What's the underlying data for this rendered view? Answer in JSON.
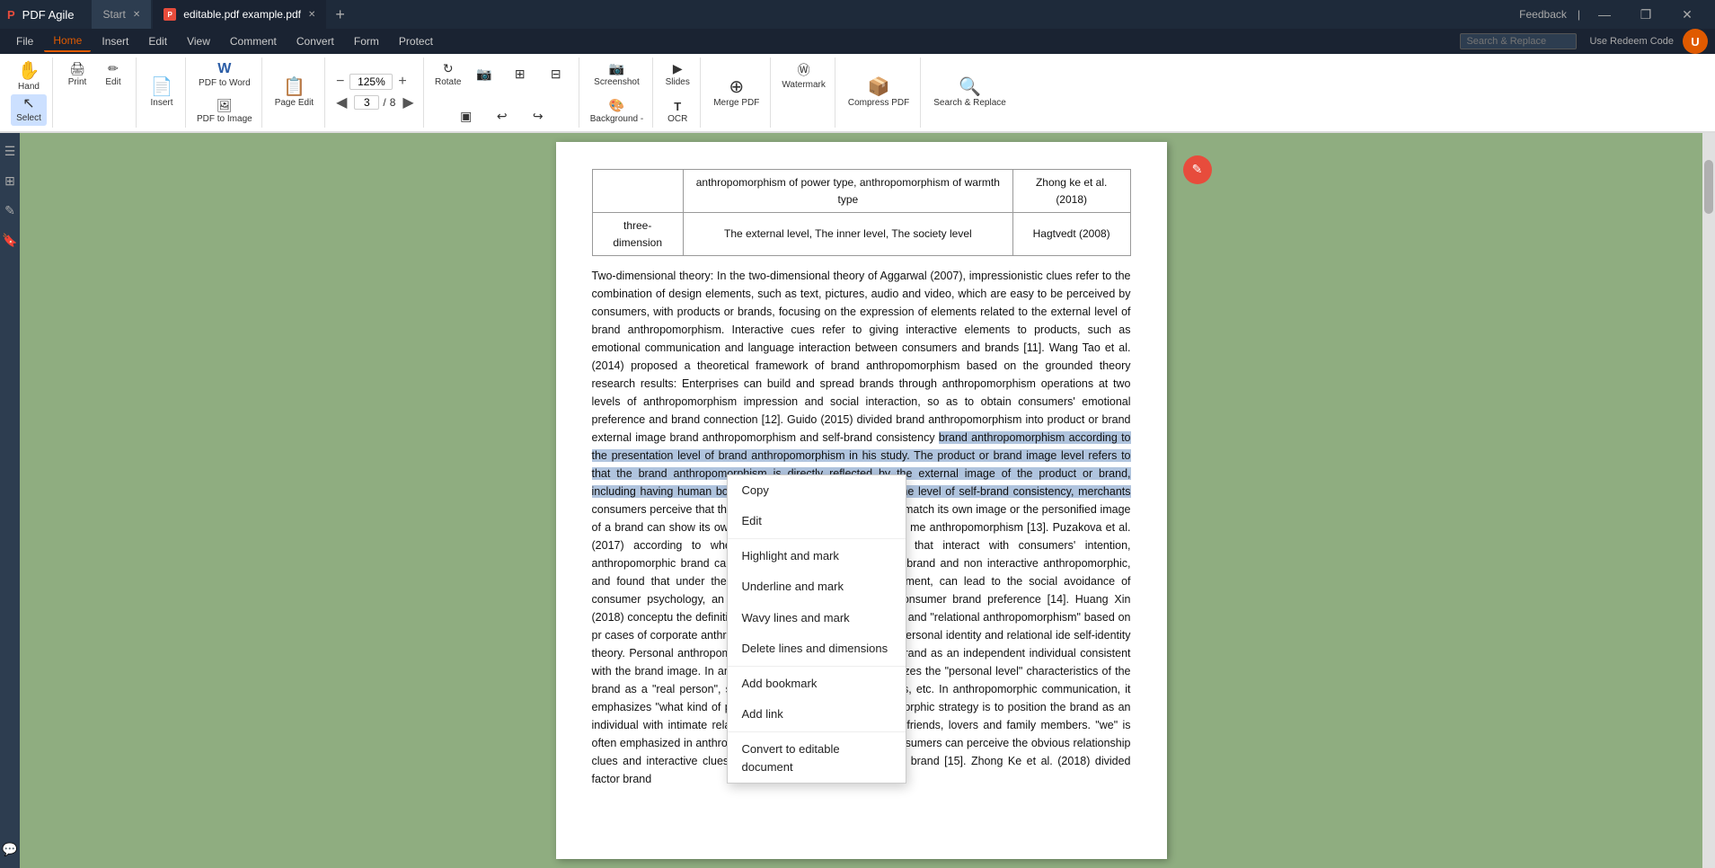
{
  "titlebar": {
    "logo": "P",
    "app_name": "PDF Agile",
    "tabs": [
      {
        "id": "start",
        "label": "Start",
        "active": false,
        "icon": null
      },
      {
        "id": "editable",
        "label": "editable.pdf example.pdf",
        "active": true,
        "icon": "P"
      }
    ],
    "add_tab": "+",
    "feedback": "Feedback",
    "window_btns": [
      "—",
      "❐",
      "✕"
    ]
  },
  "menubar": {
    "items": [
      {
        "id": "file",
        "label": "File",
        "active": false
      },
      {
        "id": "home",
        "label": "Home",
        "active": true
      },
      {
        "id": "insert",
        "label": "Insert",
        "active": false
      },
      {
        "id": "edit",
        "label": "Edit",
        "active": false
      },
      {
        "id": "view",
        "label": "View",
        "active": false
      },
      {
        "id": "comment",
        "label": "Comment",
        "active": false
      },
      {
        "id": "convert",
        "label": "Convert",
        "active": false
      },
      {
        "id": "form",
        "label": "Form",
        "active": false
      },
      {
        "id": "protect",
        "label": "Protect",
        "active": false
      }
    ]
  },
  "ribbon": {
    "groups": [
      {
        "id": "hand-select",
        "buttons": [
          {
            "id": "hand",
            "label": "Hand",
            "icon": "✋"
          },
          {
            "id": "select",
            "label": "Select",
            "icon": "↖",
            "active": true
          }
        ]
      },
      {
        "id": "print-edit-group",
        "buttons": [
          {
            "id": "print",
            "label": "Print",
            "icon": "🖨"
          },
          {
            "id": "edit",
            "label": "Edit",
            "icon": "✏"
          }
        ]
      },
      {
        "id": "insert-group",
        "buttons": [
          {
            "id": "insert",
            "label": "Insert",
            "icon": "📄",
            "has_arrow": true
          }
        ]
      },
      {
        "id": "convert-group",
        "buttons": [
          {
            "id": "pdf-to-word",
            "label": "PDF to Word",
            "icon": "W",
            "has_arrow": true
          },
          {
            "id": "pdf-to-image",
            "label": "PDF to Image",
            "icon": "🖼",
            "has_arrow": true
          }
        ]
      },
      {
        "id": "page-edit-group",
        "buttons": [
          {
            "id": "page-edit",
            "label": "Page Edit",
            "icon": "📋"
          }
        ]
      },
      {
        "id": "zoom-group",
        "zoom_out": "−",
        "zoom_value": "125%",
        "zoom_in": "+",
        "nav_prev": "◀",
        "page_current": "3",
        "page_separator": "/",
        "page_total": "8",
        "nav_next": "▶"
      },
      {
        "id": "tools-group",
        "buttons": [
          {
            "id": "rotate",
            "label": "Rotate",
            "icon": "↻"
          },
          {
            "id": "snapshot",
            "label": "",
            "icon": "📷"
          },
          {
            "id": "fit-page",
            "label": "",
            "icon": "⊞"
          },
          {
            "id": "two-page",
            "label": "",
            "icon": "⊟"
          },
          {
            "id": "single-page",
            "label": "",
            "icon": "▣"
          },
          {
            "id": "undo-page",
            "label": "",
            "icon": "↩"
          },
          {
            "id": "redo-page",
            "label": "",
            "icon": "↪"
          }
        ]
      },
      {
        "id": "screenshot-group",
        "buttons": [
          {
            "id": "screenshot",
            "label": "Screenshot",
            "icon": "📷"
          },
          {
            "id": "background",
            "label": "Background -",
            "icon": "🎨",
            "has_arrow": true
          }
        ]
      },
      {
        "id": "slides-ocr-group",
        "buttons": [
          {
            "id": "slides",
            "label": "Slides",
            "icon": "▶"
          },
          {
            "id": "ocr",
            "label": "OCR",
            "icon": "T"
          }
        ]
      },
      {
        "id": "merge-group",
        "buttons": [
          {
            "id": "merge-pdf",
            "label": "Merge PDF",
            "icon": "⊕"
          }
        ]
      },
      {
        "id": "watermark-group",
        "buttons": [
          {
            "id": "watermark",
            "label": "Watermark",
            "icon": "Ⓦ",
            "has_arrow": true
          }
        ]
      },
      {
        "id": "compress-group",
        "buttons": [
          {
            "id": "compress-pdf",
            "label": "Compress PDF",
            "icon": "📦"
          }
        ]
      },
      {
        "id": "search-group",
        "buttons": [
          {
            "id": "search-replace",
            "label": "Search & Replace",
            "icon": "🔍"
          }
        ]
      }
    ]
  },
  "search_placeholder": "Search & Replace",
  "use_redeem": "Use Redeem Code",
  "pdf_content": {
    "table": {
      "rows": [
        {
          "col1": "",
          "col2": "anthropomorphism of power type, anthropomorphism of warmth type",
          "col3": "Zhong ke et al. (2018)"
        },
        {
          "col1": "three-dimension",
          "col2": "The external level, The inner level, The society level",
          "col3": "Hagtvedt (2008)"
        }
      ]
    },
    "paragraph": "Two-dimensional theory: In the two-dimensional theory of Aggarwal (2007), impressionistic clues refer to the combination of design elements, such as text, pictures, audio and video, which are easy to be perceived by consumers, with products or brands, focusing on the expression of elements related to the external level of brand anthropomorphism. Interactive cues refer to giving interactive elements to products, such as emotional communication and language interaction between consumers and brands [11]. Wang Tao et al. (2014) proposed a theoretical framework of brand anthropomorphism based on the grounded theory research results: Enterprises can build and spread brands through anthropomorphism operations at two levels of anthropomorphism impression and social interaction, so as to obtain consumers' emotional preference and brand connection [12]. Guido (2015) divided brand anthropomorphism into product or brand external image brand anthropomorphism and self-brand consistency brand anthropomorphism according to the presentation level of brand anthropomorphism in his study. The product or brand image level refers to that the brand anthropomorphism is directly reflected by the external image of the product or brand, including having human body and human facial features. At the level of self-brand consistency, merchants consumers perceive that the personified image of a brand can match its own image or the personified image of a brand can show its own personality and characteristics by me anthropomorphism [13]. Puzakova et al. (2017) according to whether the anthropomorphic show that interact with consumers' intention, anthropomorphic brand can be divided into anthropomorphic brand and non interactive anthropomorphic, and found that under the backg of social crowded environment, can lead to the social avoidance of consumer psychology, an for interactive anthropomorphic consumer brand preference [14]. Huang Xin (2018) conceptu the definition of \"personal anthropomorphism\" and \"relational anthropomorphism\" based on pr cases of corporate anthropomorphism and the definition of personal identity and relational ide self-identity theory. Personal anthropomorphic strategy is to position the brand as an independent individual consistent with the brand image. In anthropomorphic publicity, it emphasizes the \"personal level\" characteristics of the brand as a \"real person\", such as personality, attitude, values, etc. In anthropomorphic communication, it emphasizes \"what kind of person I am\". Relational anthropomorphic strategy is to position the brand as an individual with intimate relationship with consumers, such as friends, lovers and family members. \"we\" is often emphasized in anthropomorphic communication, and consumers can perceive the obvious relationship clues and interactive clues delivered by the anthropomorphic brand [15]. Zhong Ke et al. (2018) divided factor brand",
    "selected_text_start": "brand anthropomorphism according to the presentation level of brand anthropomorphism in his study. The product or brand image level refers to that the brand anthropomorphism is directly reflected by the external image of the product or brand, including having human body and human facial features. At the level of self-brand consistency, merchants"
  },
  "context_menu": {
    "items": [
      {
        "id": "copy",
        "label": "Copy",
        "icon": ""
      },
      {
        "id": "edit",
        "label": "Edit",
        "icon": ""
      },
      {
        "id": "highlight-mark",
        "label": "Highlight and mark",
        "icon": ""
      },
      {
        "id": "underline-mark",
        "label": "Underline and mark",
        "icon": ""
      },
      {
        "id": "wavy-lines-mark",
        "label": "Wavy lines and mark",
        "icon": ""
      },
      {
        "id": "delete-lines",
        "label": "Delete lines and dimensions",
        "icon": ""
      },
      {
        "id": "add-bookmark",
        "label": "Add bookmark",
        "icon": ""
      },
      {
        "id": "add-link",
        "label": "Add link",
        "icon": ""
      },
      {
        "id": "convert-editable",
        "label": "Convert to editable document",
        "icon": ""
      }
    ]
  },
  "sidebar_left": {
    "icons": [
      "☰",
      "⊞",
      "✎",
      "🔖"
    ]
  },
  "colors": {
    "background_green": "#8fad80",
    "titlebar_bg": "#1e2a3a",
    "ribbon_active": "#e05a00",
    "selected_text_bg": "#b0c4de",
    "context_menu_bg": "#ffffff"
  }
}
